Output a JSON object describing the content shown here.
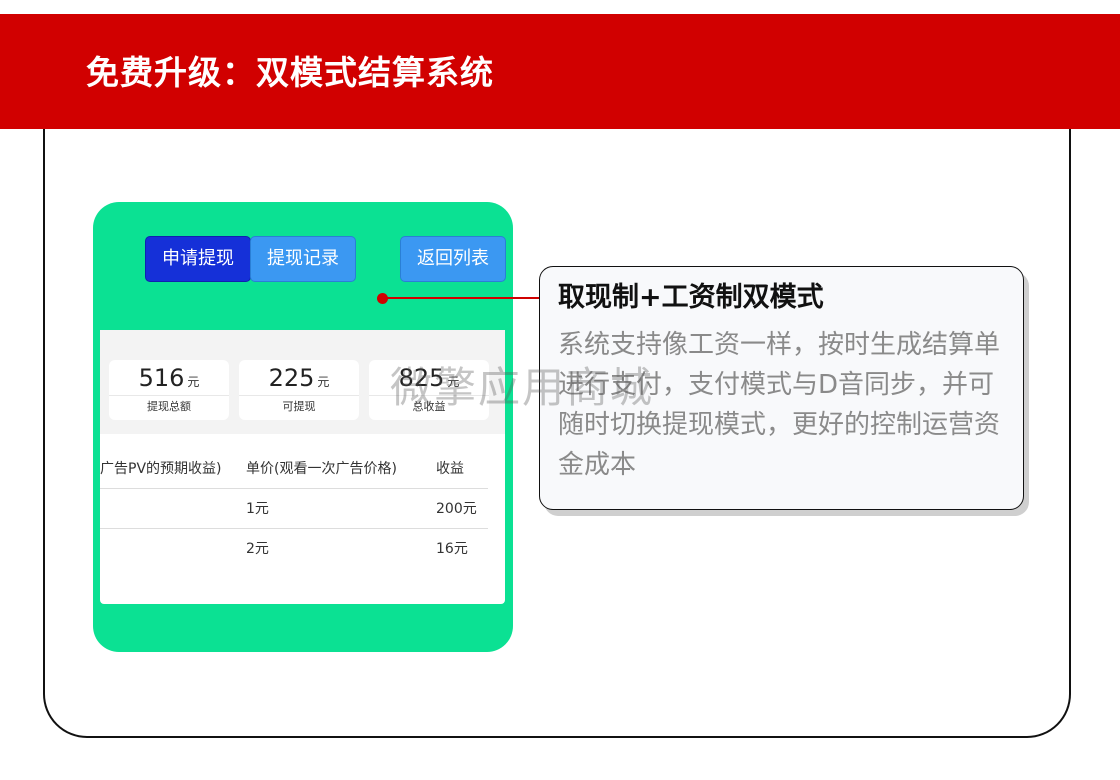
{
  "banner": {
    "title": "免费升级：双模式结算系统"
  },
  "phone": {
    "buttons": {
      "apply": "申请提现",
      "record": "提现记录",
      "back": "返回列表"
    },
    "stats": [
      {
        "value": "516",
        "unit": "元",
        "label": "提现总额"
      },
      {
        "value": "225",
        "unit": "元",
        "label": "可提现"
      },
      {
        "value": "825",
        "unit": "元",
        "label": "总收益"
      }
    ],
    "table": {
      "headers": [
        "广告PV的预期收益)",
        "单价(观看一次广告价格)",
        "收益"
      ],
      "rows": [
        [
          "",
          "1元",
          "200元"
        ],
        [
          "",
          "2元",
          "16元"
        ]
      ]
    }
  },
  "callout": {
    "title": "取现制+工资制双模式",
    "body": "系统支持像工资一样，按时生成结算单进行支付，支付模式与D音同步，并可随时切换提现模式，更好的控制运营资金成本"
  },
  "watermark": "微擎应用商城",
  "colors": {
    "banner": "#d10000",
    "phone_bg": "#0be193",
    "btn_primary": "#1530d8",
    "btn_secondary": "#3b98f2"
  }
}
